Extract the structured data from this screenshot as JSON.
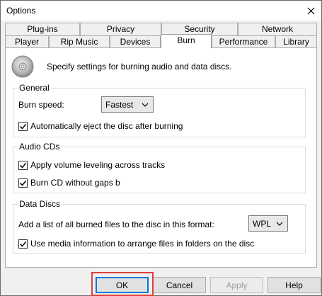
{
  "window": {
    "title": "Options"
  },
  "tabs": {
    "row1": [
      "Plug-ins",
      "Privacy",
      "Security",
      "Network"
    ],
    "row2": [
      "Player",
      "Rip Music",
      "Devices",
      "Burn",
      "Performance",
      "Library"
    ],
    "active": "Burn"
  },
  "panel": {
    "header": "Specify settings for burning audio and data discs.",
    "icon": "cd-disc-icon",
    "general": {
      "label": "General",
      "burn_speed_label": "Burn speed:",
      "burn_speed_value": "Fastest",
      "auto_eject_label": "Automatically eject the disc after burning",
      "auto_eject_checked": true
    },
    "audio_cds": {
      "label": "Audio CDs",
      "volume_leveling_label": "Apply volume leveling across tracks",
      "volume_leveling_checked": true,
      "no_gaps_label": "Burn CD without gaps b",
      "no_gaps_checked": true
    },
    "data_discs": {
      "label": "Data Discs",
      "playlist_format_label": "Add a list of all burned files to the disc in this format:",
      "playlist_format_value": "WPL",
      "media_info_label": "Use media information to arrange files in folders on the disc",
      "media_info_checked": true
    }
  },
  "buttons": {
    "ok": "OK",
    "cancel": "Cancel",
    "apply": "Apply",
    "help": "Help"
  },
  "colors": {
    "focus": "#0078d7",
    "annotation": "#e0403a"
  }
}
